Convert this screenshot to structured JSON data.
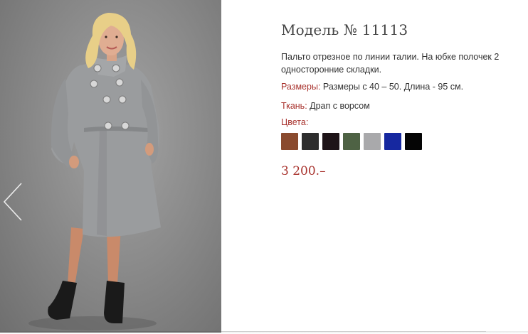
{
  "product": {
    "title": "Модель № 11113",
    "description": "Пальто отрезное по линии талии. На юбке полочек 2 односторонние складки.",
    "sizes_label": "Размеры:",
    "sizes_value": " Размеры с 40 – 50. Длина - 95 см.",
    "fabric_label": "Ткань:",
    "fabric_value": " Драп с ворсом",
    "colors_label": "Цвета:",
    "price": "3 200.–"
  },
  "swatches": [
    {
      "name": "brown",
      "color": "#8a4a2e"
    },
    {
      "name": "black-melange",
      "color": "#2e2e2e"
    },
    {
      "name": "dark-burgundy",
      "color": "#1e1418"
    },
    {
      "name": "green",
      "color": "#4e6244"
    },
    {
      "name": "light-gray",
      "color": "#a9a9ab"
    },
    {
      "name": "blue",
      "color": "#1628a0"
    },
    {
      "name": "black",
      "color": "#050505"
    }
  ],
  "icons": {
    "prev": "chevron-left-icon"
  }
}
